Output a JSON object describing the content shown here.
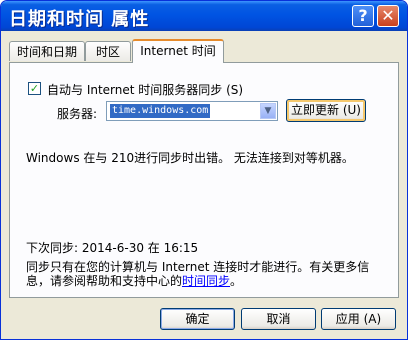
{
  "window": {
    "title": "日期和时间 属性",
    "help_label": "?",
    "close_label": "✕"
  },
  "tabs": [
    {
      "label": "时间和日期"
    },
    {
      "label": "时区"
    },
    {
      "label": "Internet 时间"
    }
  ],
  "internet_time": {
    "auto_sync_checked": true,
    "check_mark": "✓",
    "auto_sync_label": "自动与 Internet 时间服务器同步",
    "auto_sync_key": "(S)",
    "server_label": "服务器:",
    "server_value": "time.windows.com",
    "dropdown_glyph": "▼",
    "update_now_label": "立即更新 (U)",
    "error_message": "Windows 在与 210进行同步时出错。  无法连接到对等机器。",
    "next_sync": "下次同步: 2014-6-30 在 16:15",
    "note_line1": "同步只有在您的计算机与 Internet 连接时才能进行。有关更多信",
    "note_line2_prefix": "息，请参阅帮助和支持中心的",
    "note_link": "时间同步",
    "note_line2_suffix": "。"
  },
  "footer": {
    "ok_label": "确定",
    "cancel_label": "取消",
    "apply_label": "应用 (A)"
  }
}
